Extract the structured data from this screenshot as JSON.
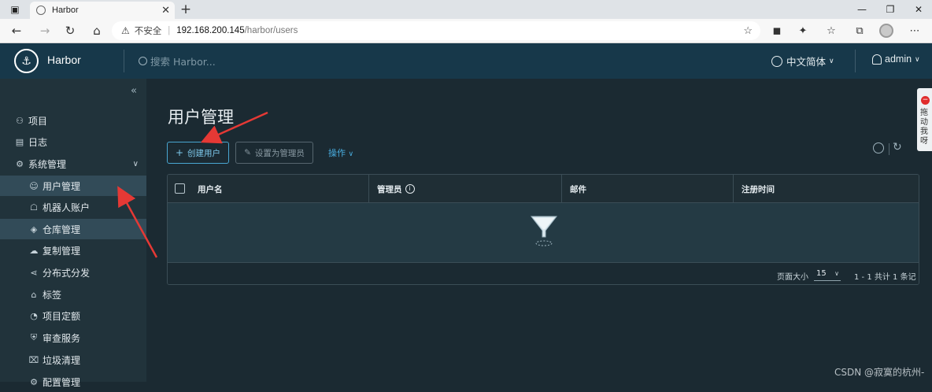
{
  "browser": {
    "tab_title": "Harbor",
    "close_glyph": "✕",
    "newtab_glyph": "+",
    "security_label": "不安全",
    "url_host": "192.168.200.145",
    "url_path": "/harbor/users"
  },
  "header": {
    "brand": "Harbor",
    "search_placeholder": "搜索 Harbor...",
    "language": "中文简体",
    "user": "admin"
  },
  "sidebar": {
    "items": [
      {
        "label": "项目",
        "icon": "projects-icon"
      },
      {
        "label": "日志",
        "icon": "logs-icon"
      },
      {
        "label": "系统管理",
        "icon": "admin-icon"
      },
      {
        "label": "用户管理",
        "icon": "users-icon"
      },
      {
        "label": "机器人账户",
        "icon": "robot-icon"
      },
      {
        "label": "仓库管理",
        "icon": "registry-icon"
      },
      {
        "label": "复制管理",
        "icon": "replication-icon"
      },
      {
        "label": "分布式分发",
        "icon": "distribution-icon"
      },
      {
        "label": "标签",
        "icon": "tag-icon"
      },
      {
        "label": "项目定额",
        "icon": "quota-icon"
      },
      {
        "label": "审查服务",
        "icon": "scanner-icon"
      },
      {
        "label": "垃圾清理",
        "icon": "trash-icon"
      },
      {
        "label": "配置管理",
        "icon": "config-icon"
      }
    ]
  },
  "main": {
    "title": "用户管理",
    "create_user": "创建用户",
    "set_admin": "设置为管理员",
    "operations": "操作",
    "columns": [
      "用户名",
      "管理员",
      "邮件",
      "注册时间"
    ],
    "page_size_label": "页面大小",
    "page_size": "15",
    "total": "1 - 1 共计 1 条记录"
  },
  "feedback": {
    "text": "拖动我呀"
  },
  "watermark": "CSDN @寂寞的杭州-",
  "colors": {
    "header_bg": "#17384a",
    "sidebar_bg": "#21333b",
    "main_bg": "#1b2a32",
    "accent": "#49a7d2",
    "arrow": "#e53935"
  }
}
